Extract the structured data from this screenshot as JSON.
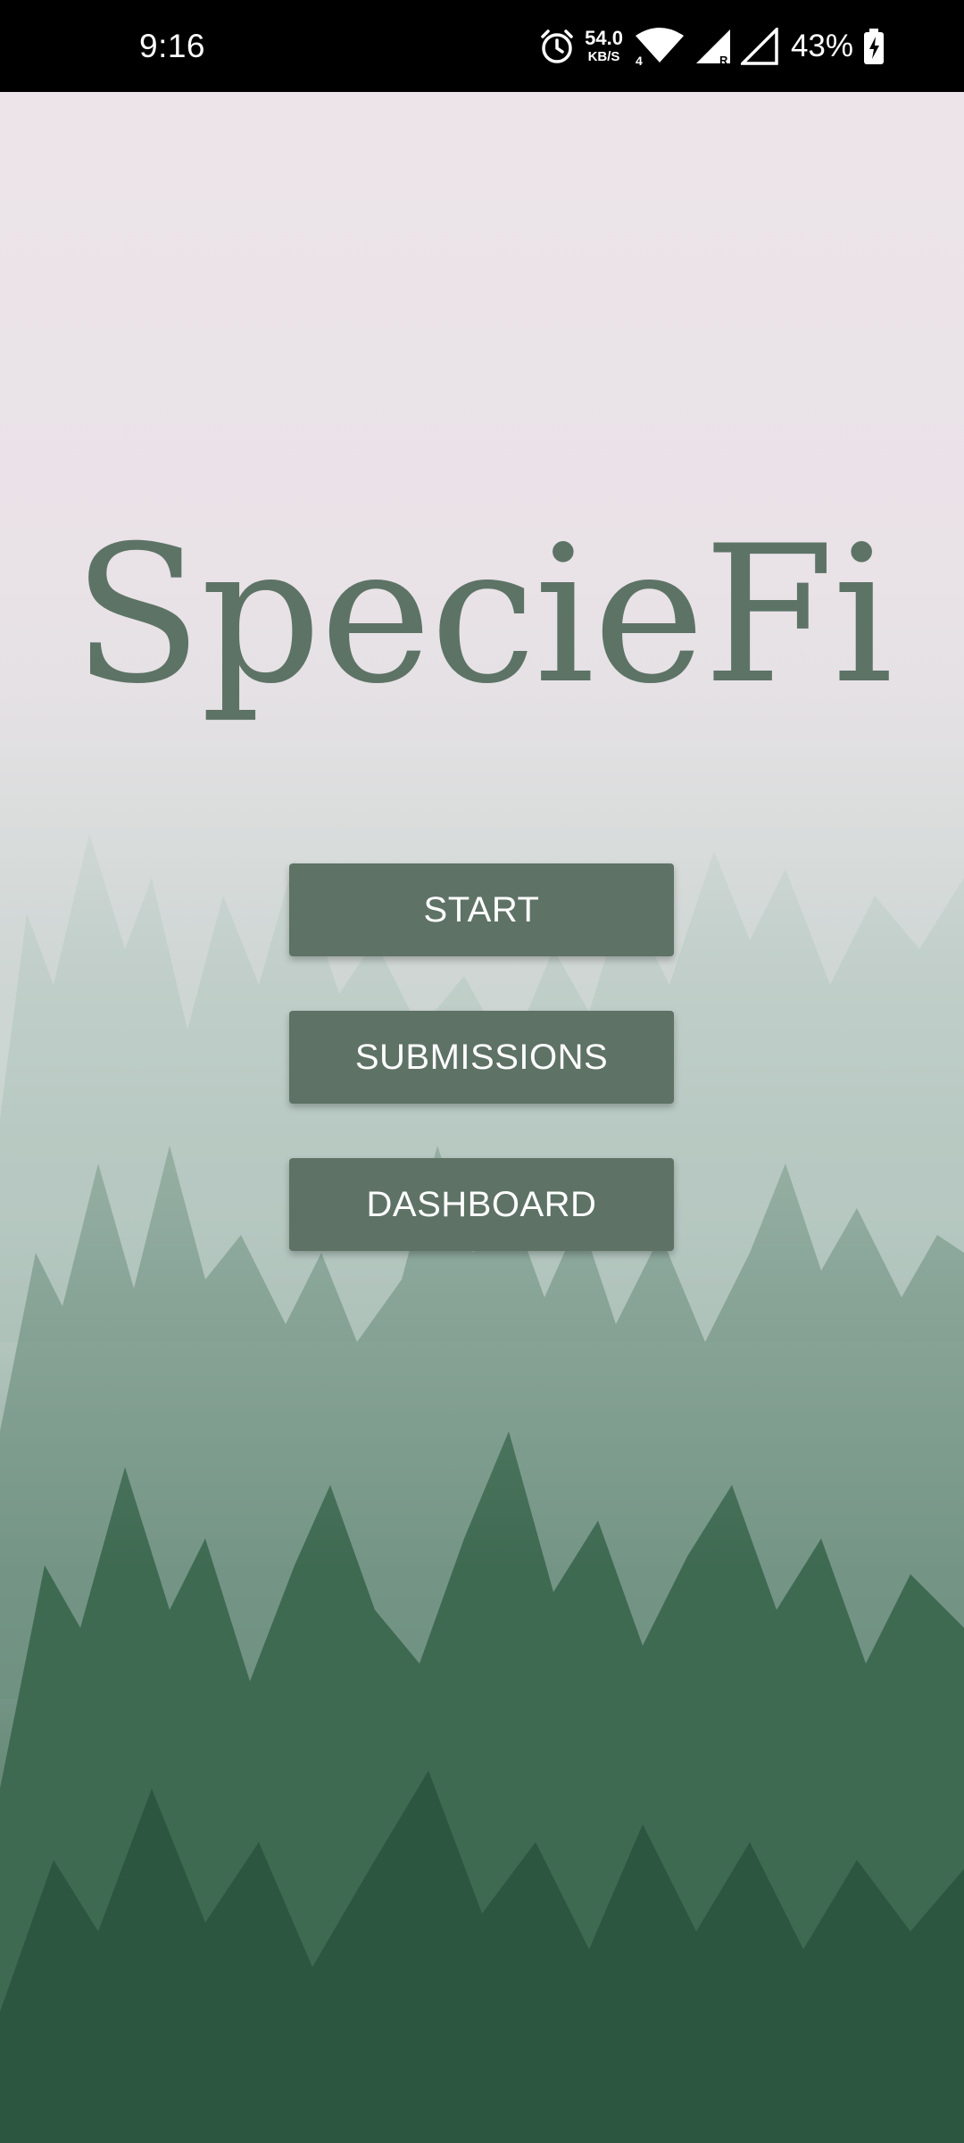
{
  "status_bar": {
    "time": "9:16",
    "net_speed_value": "54.0",
    "net_speed_unit": "KB/S",
    "battery_percent": "43%",
    "icons": [
      "alarm-icon",
      "wifi-icon",
      "signal-icon",
      "signal-roaming-icon",
      "battery-charging-icon"
    ]
  },
  "app": {
    "title": "SpecieFi"
  },
  "menu": {
    "start_label": "START",
    "submissions_label": "SUBMISSIONS",
    "dashboard_label": "DASHBOARD"
  },
  "colors": {
    "button_bg": "#5e7266",
    "title": "#5d7366",
    "background_top": "#ece4e9",
    "forest_dark": "#2f5a43"
  }
}
